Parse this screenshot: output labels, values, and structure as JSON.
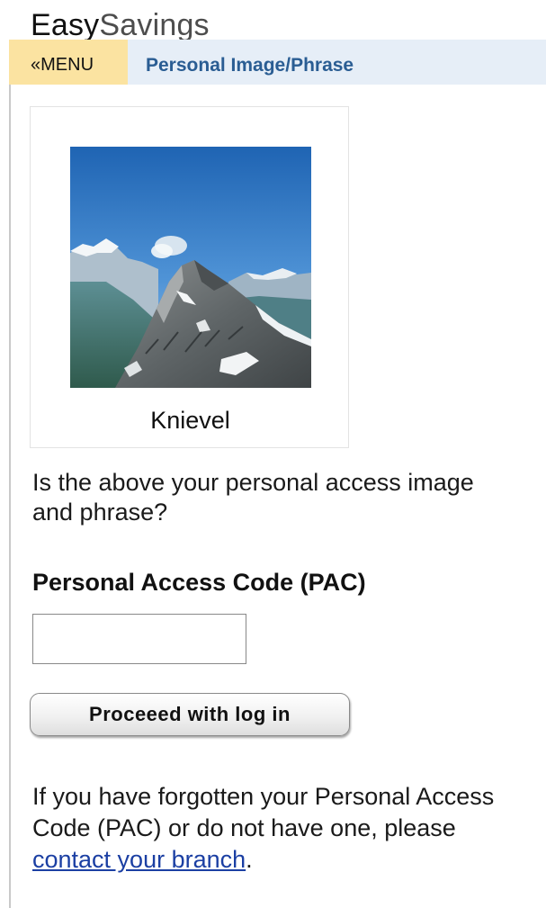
{
  "header": {
    "brand_part1": "Easy",
    "brand_part2": "Savings"
  },
  "nav": {
    "menu_label": "«MENU",
    "page_title": "Personal Image/Phrase"
  },
  "personal_image": {
    "icon": "mountain-photo",
    "phrase": "Knievel"
  },
  "question": "Is the above your personal access image and phrase?",
  "pac": {
    "label": "Personal Access Code (PAC)",
    "value": "",
    "placeholder": ""
  },
  "proceed_button": "Proceeed with log in",
  "help": {
    "text_before": "If you have forgotten your Personal Access Code (PAC) or do not have one, please ",
    "link_text": "contact your branch",
    "text_after": "."
  }
}
